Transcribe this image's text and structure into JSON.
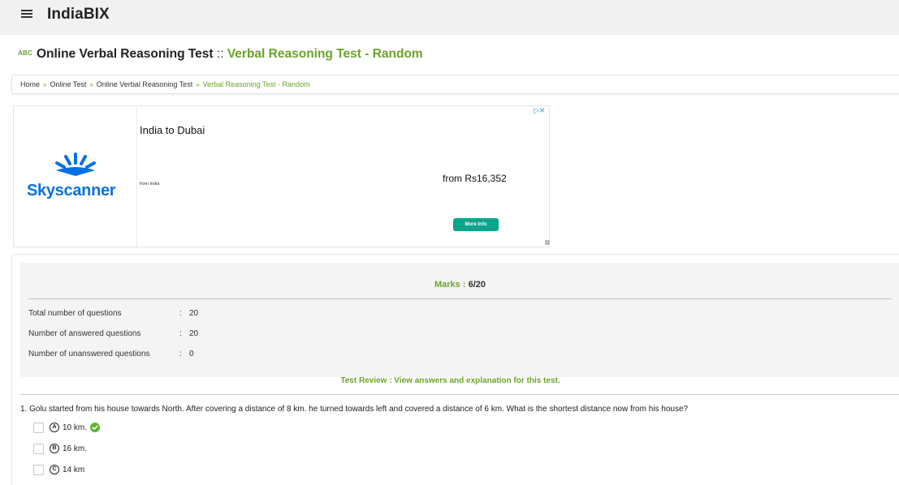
{
  "header": {
    "brand": "IndiaBIX",
    "menu_icon": "hamburger-menu-icon"
  },
  "title": {
    "icon": "ABC",
    "main": "Online Verbal Reasoning Test",
    "separator": "::",
    "sub": "Verbal Reasoning Test - Random"
  },
  "breadcrumb": {
    "items": [
      "Home",
      "Online Test",
      "Online Verbal Reasoning Test"
    ],
    "current": "Verbal Reasoning Test - Random",
    "separator": "»"
  },
  "ad": {
    "brand": "Skyscanner",
    "title": "India to Dubai",
    "from": "from India",
    "price": "from Rs16,352",
    "button": "More Info"
  },
  "result": {
    "marks_label": "Marks :",
    "marks_value": "6/20",
    "stats": [
      {
        "label": "Total number of questions",
        "value": "20"
      },
      {
        "label": "Number of answered questions",
        "value": "20"
      },
      {
        "label": "Number of unanswered questions",
        "value": "0"
      }
    ],
    "review_link": "Test Review : View answers and explanation for this test."
  },
  "question": {
    "number": "1.",
    "text": "Golu started from his house towards North. After covering a distance of 8 km. he turned towards left and covered a distance of 6 km. What is the shortest distance now from his house?",
    "options": [
      {
        "letter": "A",
        "text": "10 km.",
        "correct": true
      },
      {
        "letter": "B",
        "text": "16 km.",
        "correct": false
      },
      {
        "letter": "C",
        "text": "14 km",
        "correct": false
      }
    ]
  },
  "colors": {
    "accent": "#6aa32a",
    "skyscanner": "#0770e3",
    "ad_button": "#07a68c",
    "correct": "#5cb531"
  }
}
